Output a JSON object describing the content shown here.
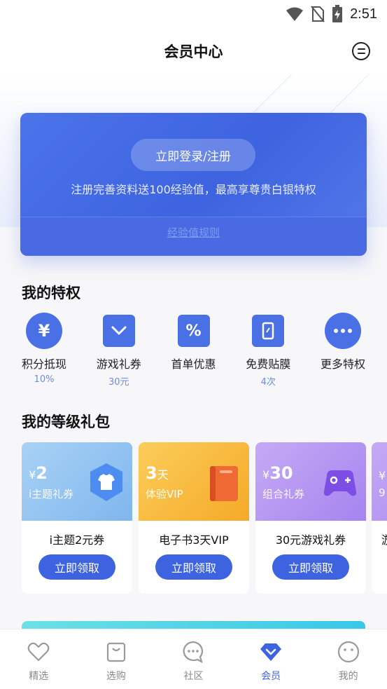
{
  "status_bar": {
    "time": "2:51",
    "icons": [
      "wifi-icon",
      "no-sim-icon",
      "battery-charging-icon"
    ]
  },
  "header": {
    "title": "会员中心",
    "message_icon": "message-icon"
  },
  "login_card": {
    "button_label": "立即登录/注册",
    "description": "注册完善资料送100经验值，最高享尊贵白银特权",
    "rule_link": "经验值规则"
  },
  "privileges": {
    "title": "我的特权",
    "items": [
      {
        "label": "积分抵现",
        "sub": "10%",
        "icon": "yen-icon"
      },
      {
        "label": "游戏礼券",
        "sub": "30元",
        "icon": "coupon-chevron-icon"
      },
      {
        "label": "首单优惠",
        "sub": "",
        "icon": "percent-icon"
      },
      {
        "label": "免费贴膜",
        "sub": "4次",
        "icon": "phone-film-icon"
      },
      {
        "label": "更多特权",
        "sub": "",
        "icon": "more-dots-icon"
      }
    ]
  },
  "gifts": {
    "title": "我的等级礼包",
    "items": [
      {
        "amount_prefix": "¥",
        "amount": "2",
        "tag": "i主题礼券",
        "name": "i主题2元券",
        "button": "立即领取",
        "icon": "tshirt-icon"
      },
      {
        "amount_prefix": "",
        "amount": "3",
        "amount_suffix": "天",
        "tag": "体验VIP",
        "name": "电子书3天VIP",
        "button": "立即领取",
        "icon": "book-icon"
      },
      {
        "amount_prefix": "¥",
        "amount": "30",
        "tag": "组合礼券",
        "name": "30元游戏礼券",
        "button": "立即领取",
        "icon": "gamepad-icon"
      },
      {
        "amount_prefix": "¥",
        "amount": "",
        "tag": "9",
        "name": "游",
        "button": "",
        "icon": ""
      }
    ]
  },
  "tabbar": {
    "items": [
      {
        "label": "精选",
        "icon": "heart-icon",
        "active": false
      },
      {
        "label": "选购",
        "icon": "shopping-bag-icon",
        "active": false
      },
      {
        "label": "社区",
        "icon": "chat-bubble-icon",
        "active": false
      },
      {
        "label": "会员",
        "icon": "diamond-icon",
        "active": true
      },
      {
        "label": "我的",
        "icon": "smile-face-icon",
        "active": false
      }
    ]
  },
  "colors": {
    "accent": "#3d63e0",
    "card_blue": "#4b73ea",
    "gift_1": "#8fc4f0",
    "gift_2": "#f7b83a",
    "gift_3": "#b598f0",
    "sub_text": "#6b8de6"
  }
}
